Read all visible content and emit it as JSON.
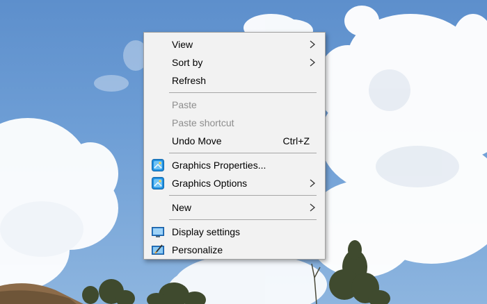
{
  "menu": {
    "items": [
      {
        "label": "View",
        "submenu": true,
        "disabled": false
      },
      {
        "label": "Sort by",
        "submenu": true,
        "disabled": false
      },
      {
        "label": "Refresh",
        "submenu": false,
        "disabled": false
      },
      {
        "label": "Paste",
        "submenu": false,
        "disabled": true
      },
      {
        "label": "Paste shortcut",
        "submenu": false,
        "disabled": true
      },
      {
        "label": "Undo Move",
        "shortcut": "Ctrl+Z",
        "submenu": false,
        "disabled": false
      },
      {
        "label": "Graphics Properties...",
        "icon": "intel-graphics-icon",
        "submenu": false,
        "disabled": false
      },
      {
        "label": "Graphics Options",
        "icon": "intel-graphics-icon",
        "submenu": true,
        "disabled": false
      },
      {
        "label": "New",
        "submenu": true,
        "disabled": false
      },
      {
        "label": "Display settings",
        "icon": "display-settings-icon",
        "submenu": false,
        "disabled": false
      },
      {
        "label": "Personalize",
        "icon": "personalize-icon",
        "submenu": false,
        "disabled": false
      }
    ]
  },
  "colors": {
    "menu_background": "#f2f2f2",
    "disabled_text": "#8d8d8d",
    "separator": "#a6a6a6",
    "sky": "#5d8fcc"
  }
}
